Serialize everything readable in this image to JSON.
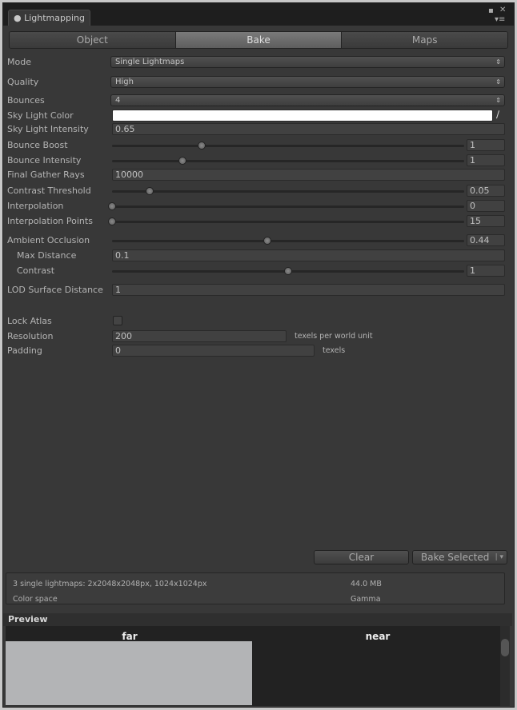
{
  "window": {
    "title": "Lightmapping"
  },
  "tabs": [
    {
      "label": "Object"
    },
    {
      "label": "Bake",
      "active": true
    },
    {
      "label": "Maps"
    }
  ],
  "fields": {
    "mode": {
      "label": "Mode",
      "value": "Single Lightmaps"
    },
    "quality": {
      "label": "Quality",
      "value": "High"
    },
    "bounces": {
      "label": "Bounces",
      "value": "4"
    },
    "sky_light_color": {
      "label": "Sky Light Color",
      "value": "#ffffff"
    },
    "sky_light_intensity": {
      "label": "Sky Light Intensity",
      "value": "0.65"
    },
    "bounce_boost": {
      "label": "Bounce Boost",
      "value": "1",
      "slider": 0.255
    },
    "bounce_intensity": {
      "label": "Bounce Intensity",
      "value": "1",
      "slider": 0.2
    },
    "final_gather_rays": {
      "label": "Final Gather Rays",
      "value": "10000"
    },
    "contrast_threshold": {
      "label": "Contrast Threshold",
      "value": "0.05",
      "slider": 0.107
    },
    "interpolation": {
      "label": "Interpolation",
      "value": "0",
      "slider": 0
    },
    "interpolation_points": {
      "label": "Interpolation Points",
      "value": "15",
      "slider": 0
    },
    "ambient_occlusion": {
      "label": "Ambient Occlusion",
      "value": "0.44",
      "slider": 0.44
    },
    "max_distance": {
      "label": "Max Distance",
      "value": "0.1"
    },
    "contrast": {
      "label": "Contrast",
      "value": "1",
      "slider": 0.5
    },
    "lod_surface_distance": {
      "label": "LOD Surface Distance",
      "value": "1"
    },
    "lock_atlas": {
      "label": "Lock Atlas",
      "checked": false
    },
    "resolution": {
      "label": "Resolution",
      "value": "200",
      "unit": "texels per world unit"
    },
    "padding": {
      "label": "Padding",
      "value": "0",
      "unit": "texels"
    }
  },
  "buttons": {
    "clear": "Clear",
    "bake_selected": "Bake Selected"
  },
  "info": {
    "summary": "3 single lightmaps: 2x2048x2048px, 1024x1024px",
    "size": "44.0 MB",
    "color_space_label": "Color space",
    "color_space_value": "Gamma"
  },
  "preview": {
    "title": "Preview",
    "far": "far",
    "near": "near"
  }
}
